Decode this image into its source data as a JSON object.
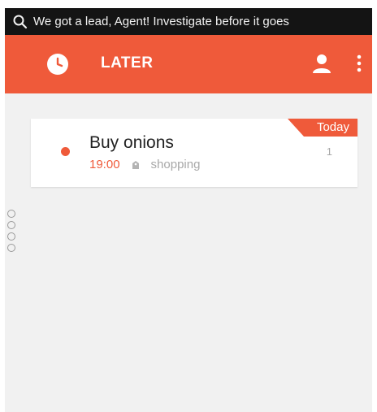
{
  "notification": {
    "text": "We got a lead, Agent! Investigate before it goes",
    "icon": "search-icon"
  },
  "app_bar": {
    "title": "LATER",
    "background_color": "#ef5a3a",
    "left_icon": "clock-icon",
    "right_icons": [
      "user-icon",
      "more-vert-icon"
    ]
  },
  "tasks": [
    {
      "title": "Buy onions",
      "time": "19:00",
      "category": "shopping",
      "category_icon": "tag-icon",
      "badge": "Today",
      "count": "1",
      "status_color": "#ef5a3a"
    }
  ],
  "page_indicator": {
    "count": 4
  }
}
